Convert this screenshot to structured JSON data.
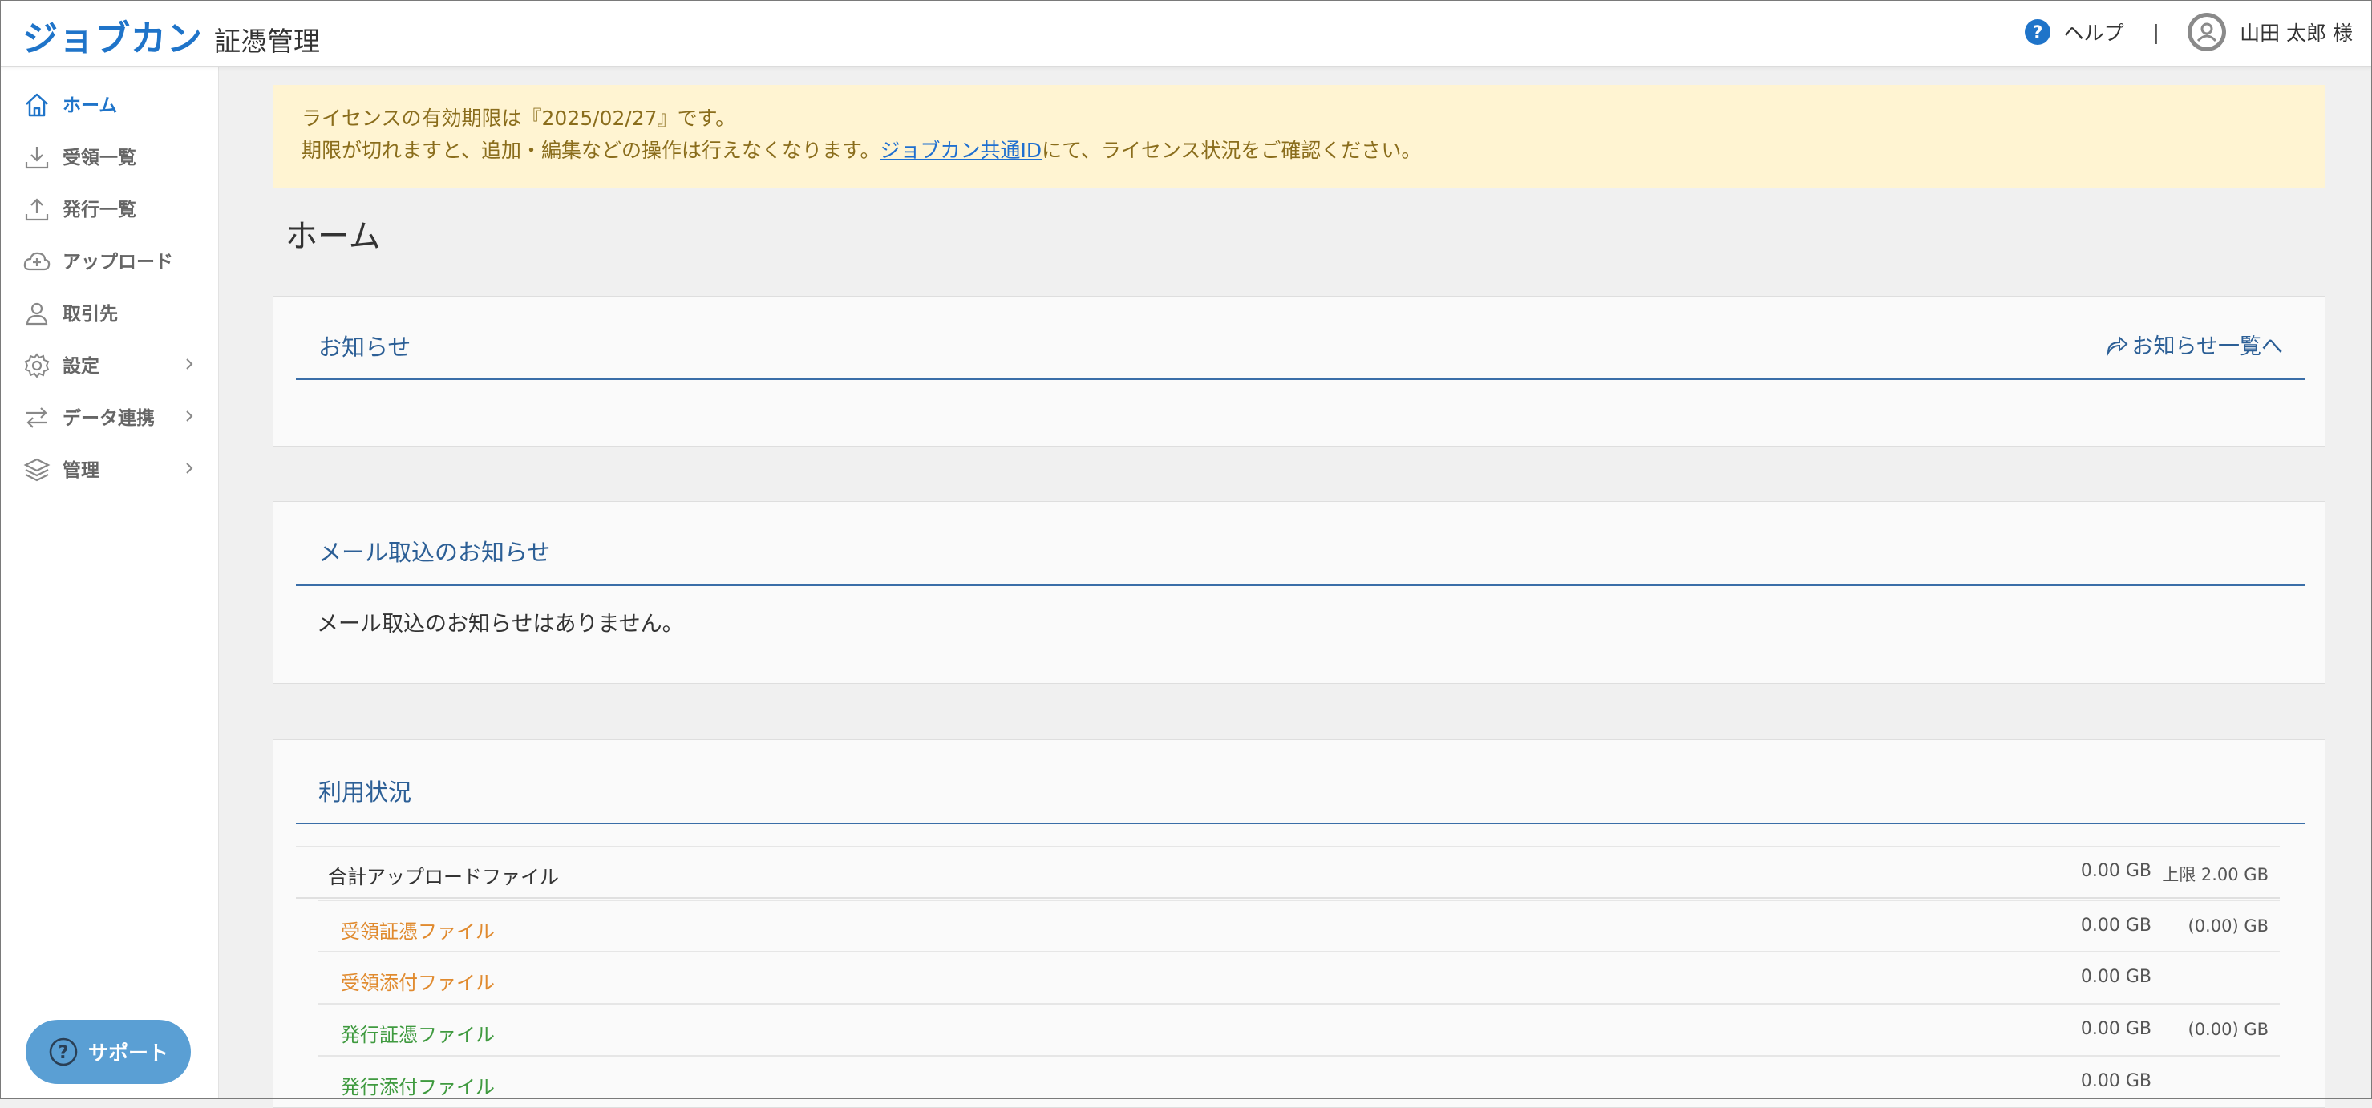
{
  "header": {
    "brand": "ジョブカン",
    "product": "証憑管理",
    "help_label": "ヘルプ",
    "separator": "|",
    "user_name": "山田 太郎 様"
  },
  "sidebar": {
    "items": [
      {
        "label": "ホーム",
        "icon": "home-icon",
        "active": true
      },
      {
        "label": "受領一覧",
        "icon": "download-icon"
      },
      {
        "label": "発行一覧",
        "icon": "upload-icon"
      },
      {
        "label": "アップロード",
        "icon": "cloud-upload-icon"
      },
      {
        "label": "取引先",
        "icon": "person-icon"
      },
      {
        "label": "設定",
        "icon": "gear-icon",
        "has_submenu": true
      },
      {
        "label": "データ連携",
        "icon": "sync-arrows-icon",
        "has_submenu": true
      },
      {
        "label": "管理",
        "icon": "layers-icon",
        "has_submenu": true
      }
    ],
    "support_label": "サポート"
  },
  "banner": {
    "line1": "ライセンスの有効期限は『2025/02/27』です。",
    "line2_prefix": "期限が切れますと、追加・編集などの操作は行えなくなります。",
    "link": "ジョブカン共通ID",
    "line2_suffix": "にて、ライセンス状況をご確認ください。"
  },
  "page": {
    "title": "ホーム"
  },
  "notices": {
    "title": "お知らせ",
    "link": "お知らせ一覧へ"
  },
  "mail_notices": {
    "title": "メール取込のお知らせ",
    "empty": "メール取込のお知らせはありません。"
  },
  "usage": {
    "title": "利用状況",
    "total": {
      "label": "合計アップロードファイル",
      "value": "0.00 GB",
      "limit": "上限 2.00 GB"
    },
    "rows": [
      {
        "label": "受領証憑ファイル",
        "value": "0.00 GB",
        "limit": "(0.00) GB",
        "color": "#e08a2e"
      },
      {
        "label": "受領添付ファイル",
        "value": "0.00 GB",
        "limit": "",
        "color": "#e08a2e"
      },
      {
        "label": "発行証憑ファイル",
        "value": "0.00 GB",
        "limit": "(0.00) GB",
        "color": "#3f9a3f"
      },
      {
        "label": "発行添付ファイル",
        "value": "0.00 GB",
        "limit": "",
        "color": "#3f9a3f"
      }
    ]
  },
  "colors": {
    "accent": "#1f74c9",
    "banner_bg": "#fff4d2",
    "heading": "#2c5f96",
    "support": "#5a9fd4"
  }
}
